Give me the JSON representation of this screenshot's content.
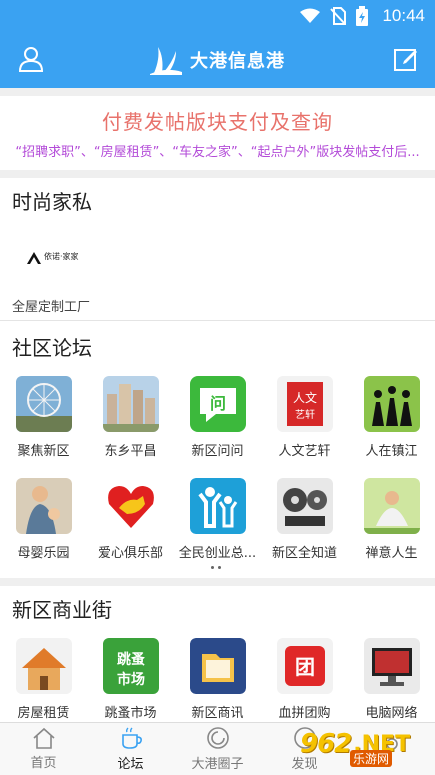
{
  "status_bar": {
    "time": "10:44"
  },
  "header": {
    "title": "大港信息港"
  },
  "pay_banner": {
    "title": "付费发帖版块支付及查询",
    "subtitle": "“招聘求职”、“房屋租赁”、“车友之家”、“起点户外”版块发帖支付后..."
  },
  "fashion": {
    "title": "时尚家私",
    "brand_logo_text": "依诺·家家",
    "caption": "全屋定制工厂"
  },
  "forum": {
    "title": "社区论坛",
    "items": [
      {
        "label": "聚焦新区",
        "icon": "ferris-wheel"
      },
      {
        "label": "东乡平昌",
        "icon": "buildings"
      },
      {
        "label": "新区问问",
        "icon": "question-chat"
      },
      {
        "label": "人文艺轩",
        "icon": "red-seal"
      },
      {
        "label": "人在镇江",
        "icon": "people-silhouette"
      },
      {
        "label": "母婴乐园",
        "icon": "mother-baby"
      },
      {
        "label": "爱心俱乐部",
        "icon": "heart-hand"
      },
      {
        "label": "全民创业总...",
        "icon": "people-up"
      },
      {
        "label": "新区全知道",
        "icon": "film-reels"
      },
      {
        "label": "禅意人生",
        "icon": "meditation"
      }
    ]
  },
  "business": {
    "title": "新区商业街",
    "items": [
      {
        "label": "房屋租赁",
        "icon": "house"
      },
      {
        "label": "跳蚤市场",
        "icon": "flea-market"
      },
      {
        "label": "新区商讯",
        "icon": "folder"
      },
      {
        "label": "血拼团购",
        "icon": "group-buy"
      },
      {
        "label": "电脑网络",
        "icon": "computer"
      }
    ]
  },
  "tabs": [
    {
      "label": "首页",
      "icon": "home-icon"
    },
    {
      "label": "论坛",
      "icon": "cup-icon"
    },
    {
      "label": "大港圈子",
      "icon": "circle-icon"
    },
    {
      "label": "发现",
      "icon": "discover-icon"
    },
    {
      "label": "",
      "icon": "me-icon"
    }
  ],
  "watermark": {
    "number": "962",
    "suffix": ".NET",
    "cn": "乐游网"
  },
  "colors": {
    "brand_blue": "#3aa2f2",
    "pay_title": "#e8726b",
    "pay_sub": "#b34bd8"
  }
}
